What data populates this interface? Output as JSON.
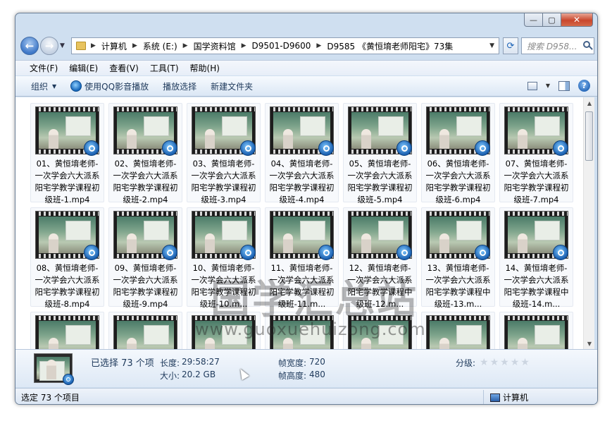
{
  "window": {
    "caption_buttons": {
      "min": "—",
      "max": "▢",
      "close": "✕"
    }
  },
  "nav": {
    "back_icon": "back-arrow-icon",
    "forward_icon": "forward-arrow-icon",
    "breadcrumbs": [
      "计算机",
      "系统 (E:)",
      "国学资料馆",
      "D9501-D9600",
      "D9585 《黄恒堉老师阳宅》73集"
    ],
    "search_placeholder": "搜索 D958..."
  },
  "menu": [
    "文件(F)",
    "编辑(E)",
    "查看(V)",
    "工具(T)",
    "帮助(H)"
  ],
  "commands": {
    "organize": "组织",
    "qq_play": "使用QQ影音播放",
    "play_selection": "播放选择",
    "new_folder": "新建文件夹"
  },
  "files": [
    "01、黄恒堉老师-一次学会六大派系阳宅学教学课程初级班-1.mp4",
    "02、黄恒堉老师-一次学会六大派系阳宅学教学课程初级班-2.mp4",
    "03、黄恒堉老师-一次学会六大派系阳宅学教学课程初级班-3.mp4",
    "04、黄恒堉老师-一次学会六大派系阳宅学教学课程初级班-4.mp4",
    "05、黄恒堉老师-一次学会六大派系阳宅学教学课程初级班-5.mp4",
    "06、黄恒堉老师-一次学会六大派系阳宅学教学课程初级班-6.mp4",
    "07、黄恒堉老师-一次学会六大派系阳宅学教学课程初级班-7.mp4",
    "08、黄恒堉老师-一次学会六大派系阳宅学教学课程初级班-8.mp4",
    "09、黄恒堉老师-一次学会六大派系阳宅学教学课程初级班-9.mp4",
    "10、黄恒堉老师-一次学会六大派系阳宅学教学课程初级班-10.m...",
    "11、黄恒堉老师-一次学会六大派系阳宅学教学课程初级班-11.m...",
    "12、黄恒堉老师-一次学会六大派系阳宅学教学课程中级班-12.m...",
    "13、黄恒堉老师-一次学会六大派系阳宅学教学课程中级班-13.m...",
    "14、黄恒堉老师-一次学会六大派系阳宅学教学课程中级班-14.m..."
  ],
  "watermark": {
    "title": "国学汇总站",
    "url": "www.guoxuehuizong.com"
  },
  "details": {
    "selected": "已选择 73 个项",
    "length_label": "长度:",
    "length": "29:58:27",
    "size_label": "大小:",
    "size": "20.2 GB",
    "width_label": "帧宽度:",
    "width": "720",
    "height_label": "帧高度:",
    "height": "480",
    "rating_label": "分级:",
    "rating": 0
  },
  "status": {
    "left": "选定 73 个项目",
    "right": "计算机"
  }
}
